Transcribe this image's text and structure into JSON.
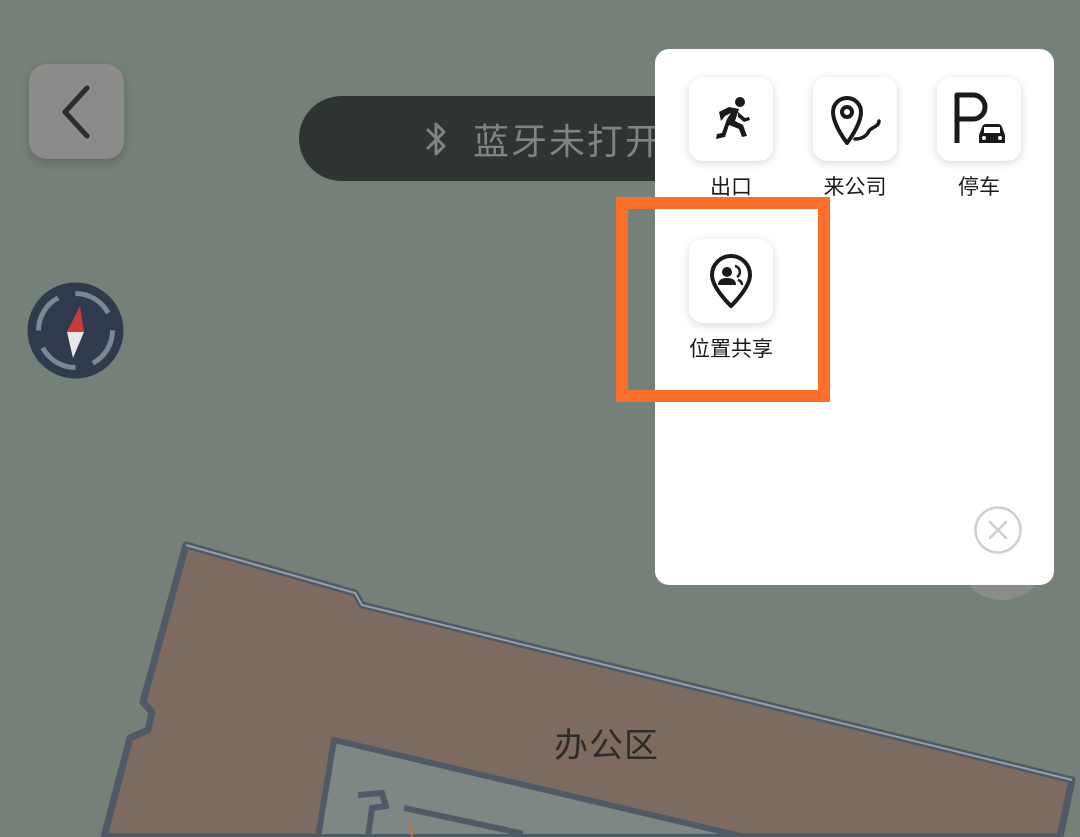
{
  "map": {
    "area_label": "办公区",
    "colors": {
      "background": "#758079",
      "building_fill": "#7d6b61",
      "building_outline": "#4f5a66",
      "corridor_fill": "#7f8785",
      "accent_highlight": "#fb6f2c"
    }
  },
  "header": {
    "back_icon": "chevron-left-icon",
    "bluetooth_icon": "bluetooth-icon",
    "bluetooth_status": "蓝牙未打开"
  },
  "compass": {
    "icon": "compass-icon"
  },
  "menu_panel": {
    "items": [
      {
        "label": "出口",
        "icon": "exit-running-person-icon"
      },
      {
        "label": "来公司",
        "icon": "location-route-icon"
      },
      {
        "label": "停车",
        "icon": "parking-car-icon"
      },
      {
        "label": "位置共享",
        "icon": "location-share-icon"
      }
    ],
    "close_icon": "close-circle-icon"
  }
}
